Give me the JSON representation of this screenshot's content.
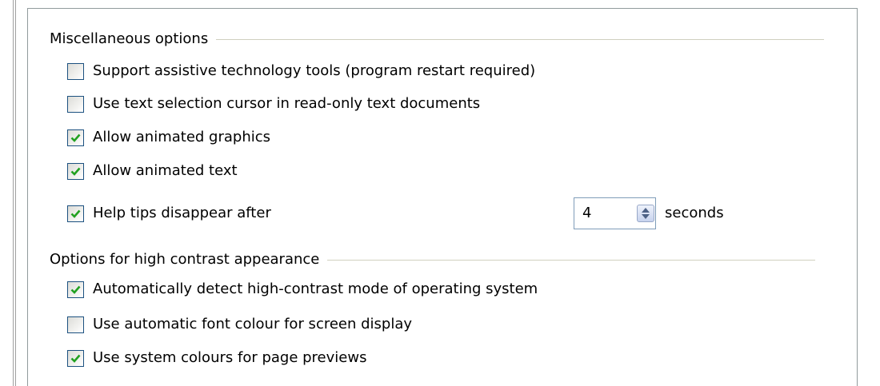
{
  "misc": {
    "title": "Miscellaneous options",
    "assistive": {
      "label": "Support assistive technology tools (program restart required)",
      "checked": false
    },
    "text_cursor": {
      "label": "Use text selection cursor in read-only text documents",
      "checked": false
    },
    "animated_graphics": {
      "label": "Allow animated graphics",
      "checked": true
    },
    "animated_text": {
      "label": "Allow animated text",
      "checked": true
    },
    "help_tips": {
      "label": "Help tips disappear after",
      "checked": true,
      "value": "4",
      "unit": "seconds"
    }
  },
  "contrast": {
    "title": "Options for high contrast appearance",
    "auto_detect": {
      "label": "Automatically detect high-contrast mode of operating system",
      "checked": true
    },
    "auto_font": {
      "label": "Use automatic font colour for screen display",
      "checked": false
    },
    "system_colours": {
      "label": "Use system colours for page previews",
      "checked": true
    }
  },
  "colors": {
    "check_mark": "#21a121",
    "checkbox_border": "#1c5180",
    "separator": "#d0d0bf"
  },
  "icons": {
    "check": "check-icon",
    "spin": "spin-arrows-icon"
  }
}
